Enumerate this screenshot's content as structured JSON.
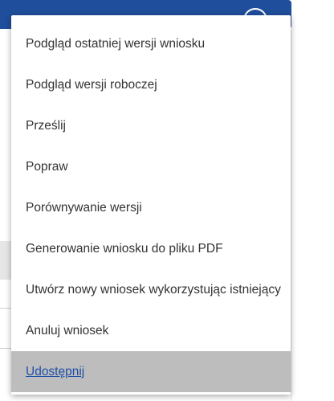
{
  "menu": {
    "items": [
      {
        "label": "Podgląd ostatniej wersji wniosku"
      },
      {
        "label": "Podgląd wersji roboczej"
      },
      {
        "label": "Prześlij"
      },
      {
        "label": "Popraw"
      },
      {
        "label": "Porównywanie wersji"
      },
      {
        "label": "Generowanie wniosku do pliku PDF"
      },
      {
        "label": "Utwórz nowy wniosek wykorzystując istniejący"
      },
      {
        "label": "Anuluj wniosek"
      },
      {
        "label": "Udostępnij",
        "state": "hovered"
      }
    ]
  },
  "colors": {
    "header_bg": "#1f4e9c",
    "highlight_bg": "#bdbdbd",
    "highlight_text": "#1e4fa8",
    "item_text": "#333333"
  }
}
